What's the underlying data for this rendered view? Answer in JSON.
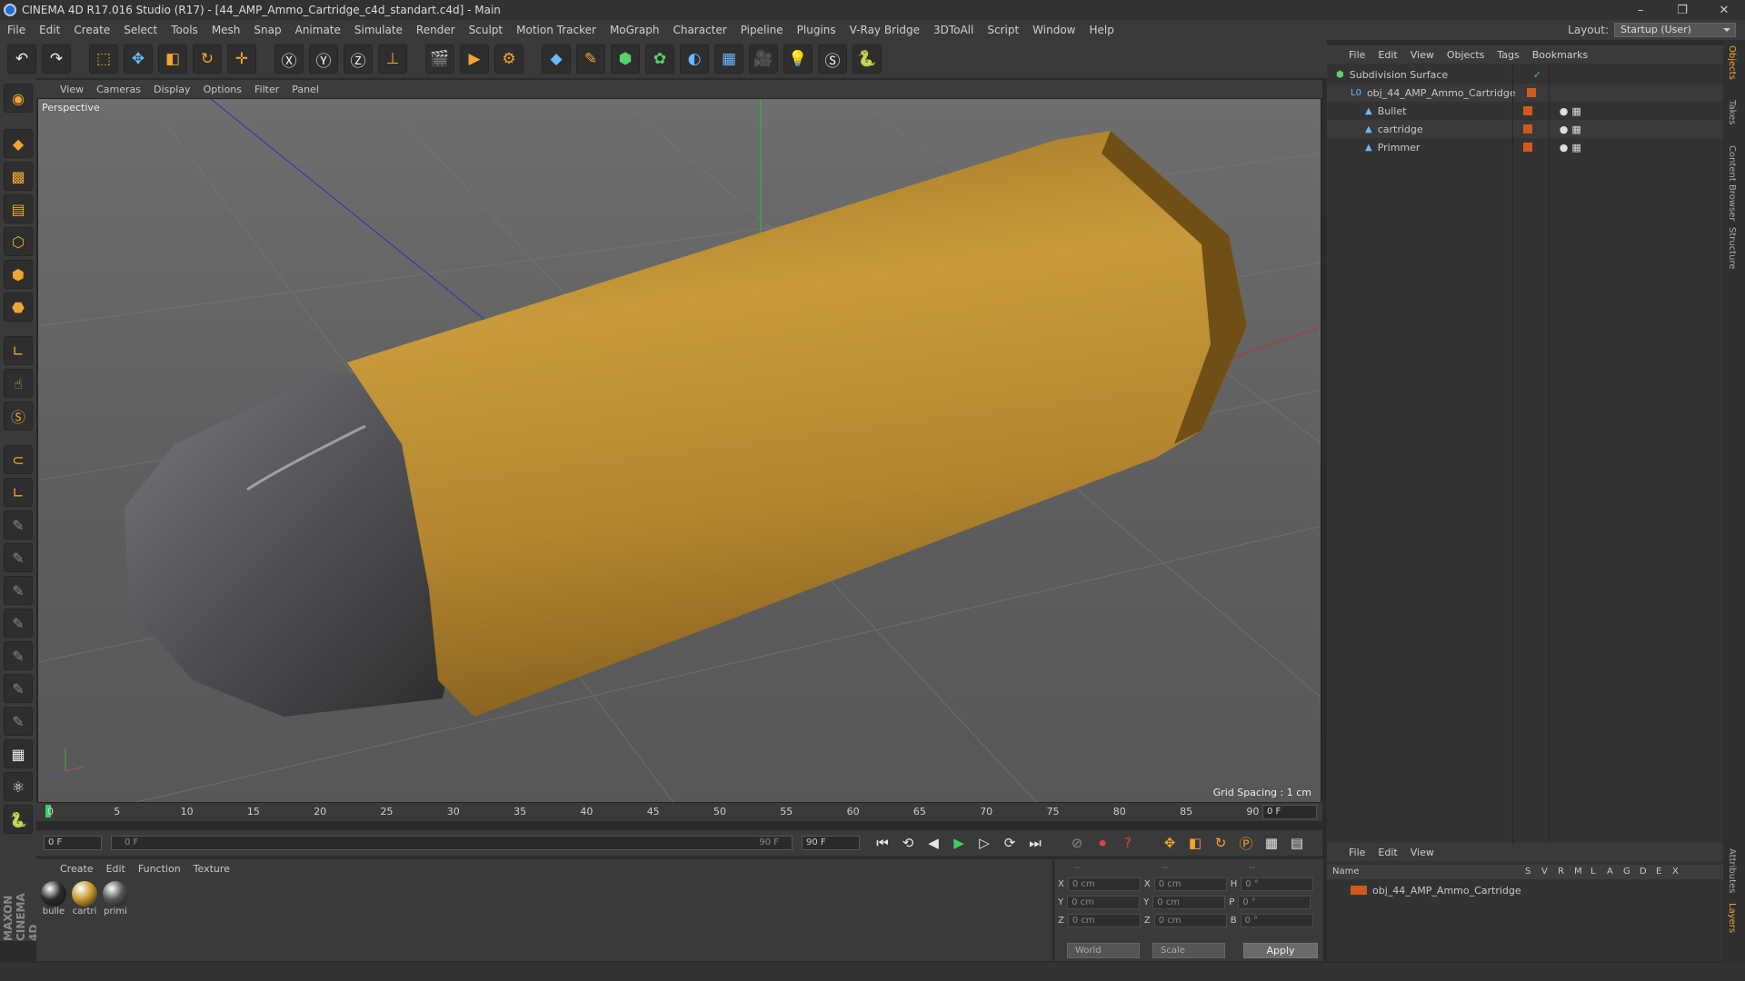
{
  "window": {
    "title": "CINEMA 4D R17.016 Studio (R17) - [44_AMP_Ammo_Cartridge_c4d_standart.c4d] - Main",
    "min": "–",
    "max": "❐",
    "close": "✕"
  },
  "menu": [
    "File",
    "Edit",
    "Create",
    "Select",
    "Tools",
    "Mesh",
    "Snap",
    "Animate",
    "Simulate",
    "Render",
    "Sculpt",
    "Motion Tracker",
    "MoGraph",
    "Character",
    "Pipeline",
    "Plugins",
    "V-Ray Bridge",
    "3DToAll",
    "Script",
    "Window",
    "Help"
  ],
  "layout": {
    "label": "Layout:",
    "value": "Startup (User)"
  },
  "viewport": {
    "menu": [
      "View",
      "Cameras",
      "Display",
      "Options",
      "Filter",
      "Panel"
    ],
    "camera": "Perspective",
    "grid_spacing": "Grid Spacing : 1 cm"
  },
  "timeline": {
    "ticks": [
      "0",
      "5",
      "10",
      "15",
      "20",
      "25",
      "30",
      "35",
      "40",
      "45",
      "50",
      "55",
      "60",
      "65",
      "70",
      "75",
      "80",
      "85",
      "90"
    ],
    "current": "0 F"
  },
  "transport": {
    "start": "0 F",
    "range_start": "0 F",
    "range_end": "90 F",
    "end": "90 F"
  },
  "materials": {
    "menu": [
      "Create",
      "Edit",
      "Function",
      "Texture"
    ],
    "items": [
      {
        "label": "bulle",
        "color": "#2a2a2a"
      },
      {
        "label": "cartri",
        "color": "#c89a2c"
      },
      {
        "label": "primi",
        "color": "#555555"
      }
    ]
  },
  "coords": {
    "rows": [
      {
        "a": "X",
        "av": "0 cm",
        "b": "X",
        "bv": "0 cm",
        "c": "H",
        "cv": "0 °"
      },
      {
        "a": "Y",
        "av": "0 cm",
        "b": "Y",
        "bv": "0 cm",
        "c": "P",
        "cv": "0 °"
      },
      {
        "a": "Z",
        "av": "0 cm",
        "b": "Z",
        "bv": "0 cm",
        "c": "B",
        "cv": "0 °"
      }
    ],
    "head": [
      "--",
      "--",
      "--"
    ],
    "space": "World",
    "mode": "Scale",
    "apply": "Apply"
  },
  "objects": {
    "menu": [
      "File",
      "Edit",
      "View",
      "Objects",
      "Tags",
      "Bookmarks"
    ],
    "items": [
      {
        "name": "Subdivision Surface",
        "indent": 0
      },
      {
        "name": "obj_44_AMP_Ammo_Cartridge",
        "indent": 1
      },
      {
        "name": "Bullet",
        "indent": 2
      },
      {
        "name": "cartridge",
        "indent": 2
      },
      {
        "name": "Primmer",
        "indent": 2
      }
    ]
  },
  "attributes": {
    "menu": [
      "File",
      "Edit",
      "View"
    ],
    "cols": [
      "Name",
      "S",
      "V",
      "R",
      "M",
      "L",
      "A",
      "G",
      "D",
      "E",
      "X"
    ],
    "row": "obj_44_AMP_Ammo_Cartridge"
  },
  "side_tabs": [
    "Objects",
    "Takes",
    "Content Browser",
    "Structure"
  ],
  "side_tabs2": [
    "Attributes",
    "Layers"
  ],
  "brand": "MAXON CINEMA 4D"
}
